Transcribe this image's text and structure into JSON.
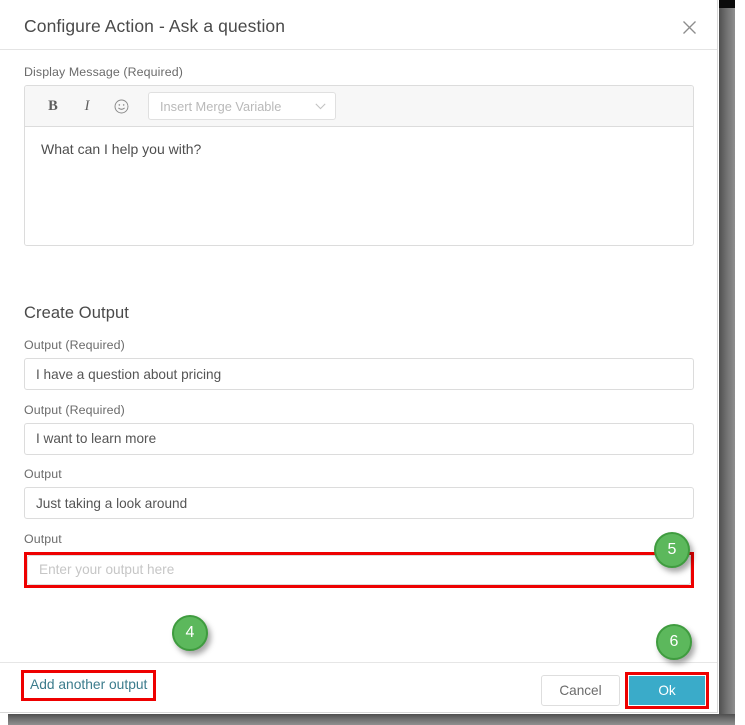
{
  "dialog": {
    "title": "Configure Action - Ask a question",
    "close_icon": "close-icon"
  },
  "display_message": {
    "label": "Display Message (Required)",
    "toolbar": {
      "bold_label": "B",
      "italic_label": "I",
      "emoji_icon": "smiley-icon",
      "merge_variable_placeholder": "Insert Merge Variable",
      "chevron_icon": "chevron-down-icon"
    },
    "content": "What can I help you with?"
  },
  "create_output": {
    "heading": "Create Output",
    "outputs": [
      {
        "label": "Output (Required)",
        "value": "I have a question about pricing",
        "placeholder": "Enter your output here",
        "highlighted": false
      },
      {
        "label": "Output (Required)",
        "value": "I want to learn more",
        "placeholder": "Enter your output here",
        "highlighted": false
      },
      {
        "label": "Output",
        "value": "Just taking a look around",
        "placeholder": "Enter your output here",
        "highlighted": false
      },
      {
        "label": "Output",
        "value": "",
        "placeholder": "Enter your output here",
        "highlighted": true
      }
    ],
    "add_another_label": "Add another output"
  },
  "footer": {
    "cancel_label": "Cancel",
    "ok_label": "Ok"
  },
  "callouts": [
    {
      "number": "4"
    },
    {
      "number": "5"
    },
    {
      "number": "6"
    }
  ],
  "colors": {
    "accent_primary": "#3aabc9",
    "highlight_outline": "#ee0000",
    "callout_fill": "#5cb85c",
    "callout_border": "#3f9c3f",
    "link": "#3c7c8c"
  }
}
